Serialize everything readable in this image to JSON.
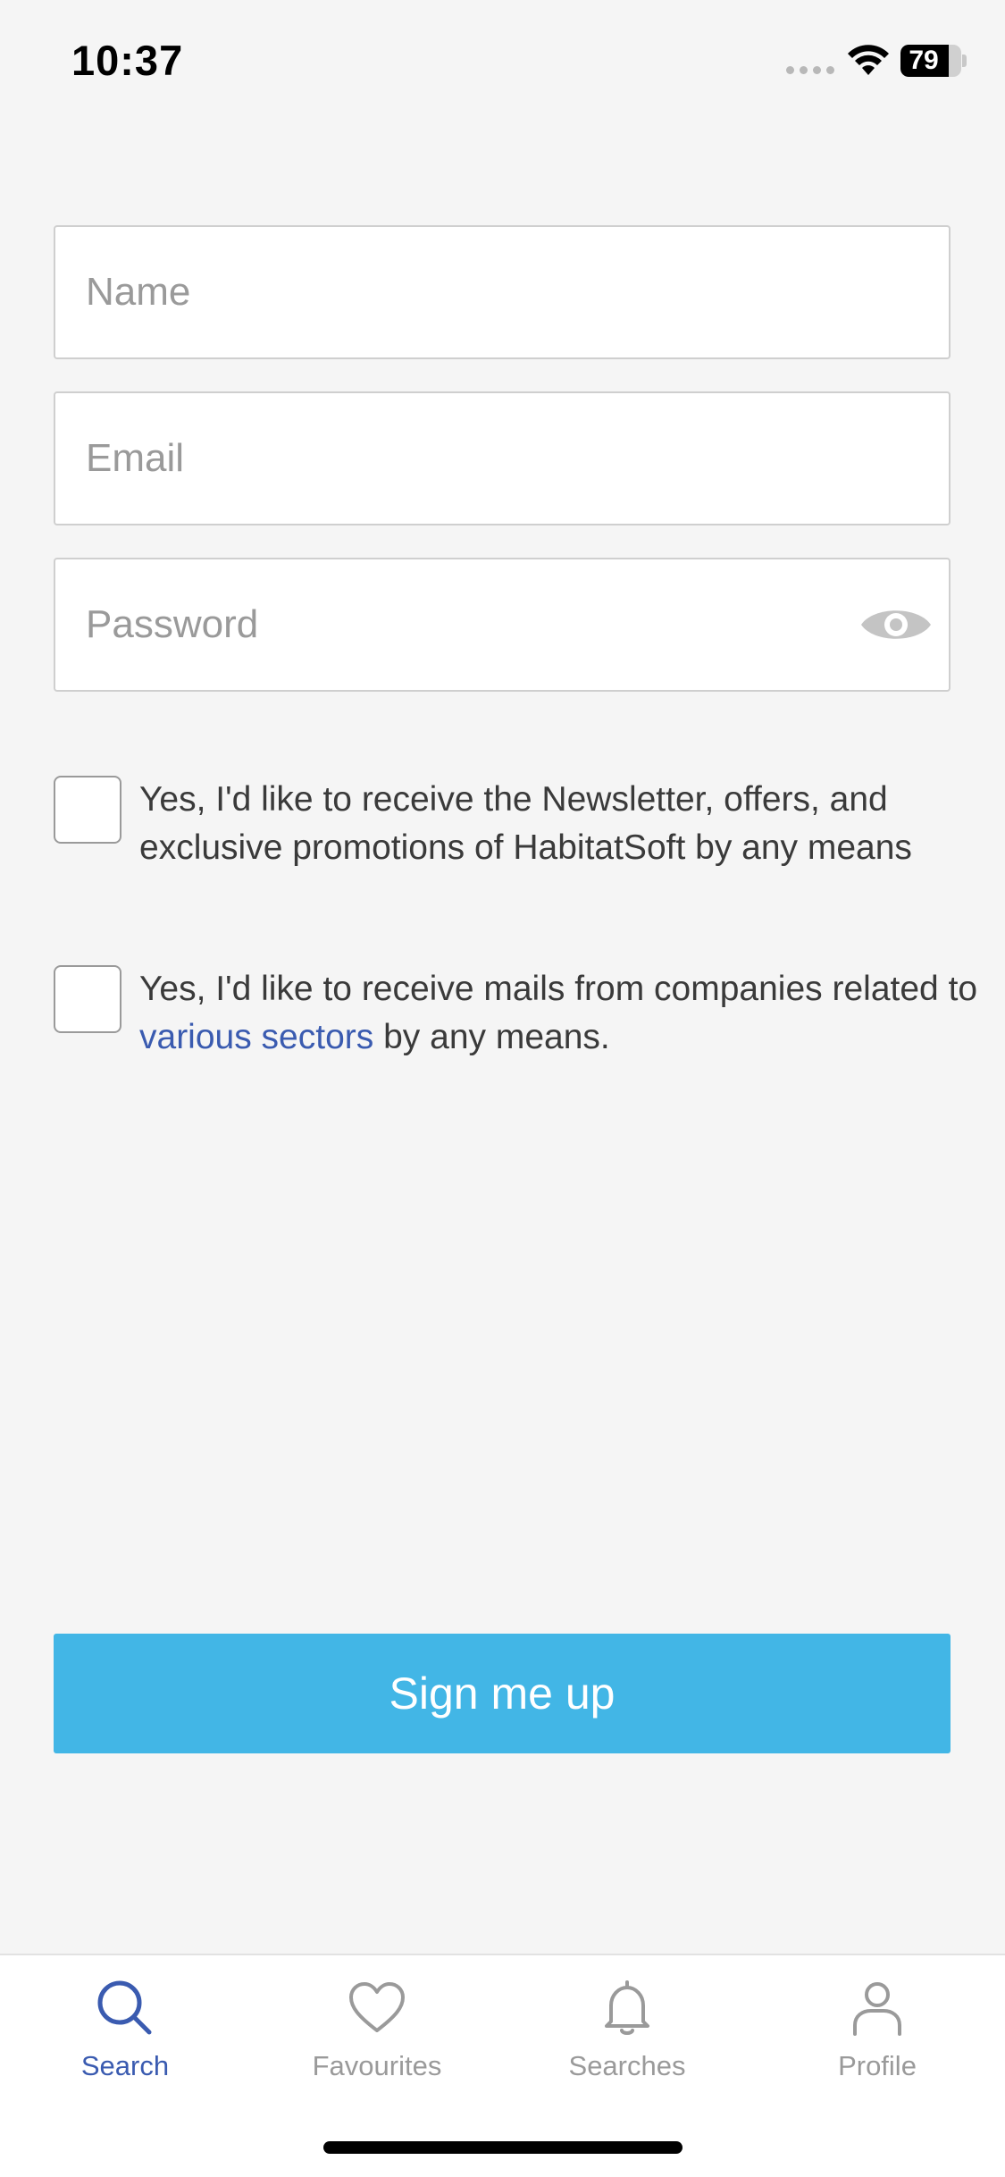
{
  "status_bar": {
    "time": "10:37",
    "battery_level": "79"
  },
  "form": {
    "name_placeholder": "Name",
    "email_placeholder": "Email",
    "password_placeholder": "Password",
    "name_value": "",
    "email_value": "",
    "password_value": ""
  },
  "consents": [
    {
      "checked": false,
      "text": "Yes, I'd like to receive the Newsletter, offers, and exclusive promotions of HabitatSoft by any means"
    },
    {
      "checked": false,
      "text_before": "Yes, I'd like to receive mails from companies related to ",
      "link_text": "various sectors",
      "text_after": " by any means."
    }
  ],
  "signup_button_label": "Sign me up",
  "tabs": [
    {
      "label": "Search",
      "icon": "search-icon",
      "active": true
    },
    {
      "label": "Favourites",
      "icon": "heart-icon",
      "active": false
    },
    {
      "label": "Searches",
      "icon": "bell-icon",
      "active": false
    },
    {
      "label": "Profile",
      "icon": "person-icon",
      "active": false
    }
  ],
  "colors": {
    "accent": "#42b6e6",
    "link": "#3a5bb0",
    "active_tab": "#3a5bb0",
    "inactive_tab": "#9a9a9a",
    "background": "#f5f5f5"
  }
}
